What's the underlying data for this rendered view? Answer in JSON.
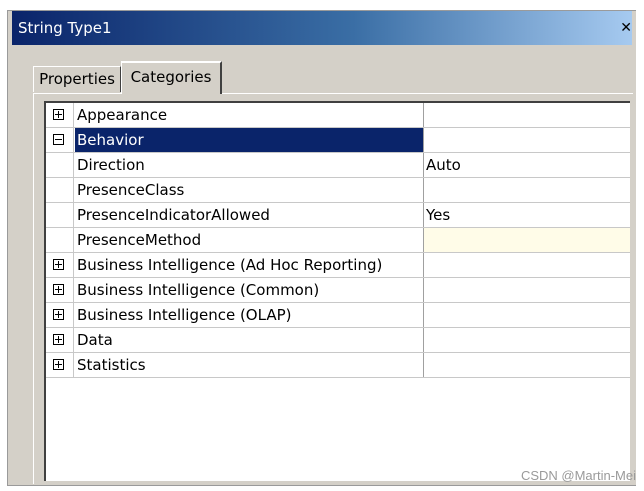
{
  "window": {
    "title": "String Type1",
    "close_glyph": "✕"
  },
  "tabs": [
    {
      "label": "Properties",
      "active": false
    },
    {
      "label": "Categories",
      "active": true
    }
  ],
  "grid": {
    "rows": [
      {
        "name": "Appearance",
        "value": "",
        "expander": "plus"
      },
      {
        "name": "Behavior",
        "value": "",
        "expander": "minus",
        "selected": true
      },
      {
        "name": "Direction",
        "value": "Auto"
      },
      {
        "name": "PresenceClass",
        "value": ""
      },
      {
        "name": "PresenceIndicatorAllowed",
        "value": "Yes"
      },
      {
        "name": "PresenceMethod",
        "value": "",
        "highlight": true
      },
      {
        "name": "Business Intelligence (Ad Hoc Reporting)",
        "value": "",
        "expander": "plus"
      },
      {
        "name": "Business Intelligence (Common)",
        "value": "",
        "expander": "plus"
      },
      {
        "name": "Business Intelligence (OLAP)",
        "value": "",
        "expander": "plus"
      },
      {
        "name": "Data",
        "value": "",
        "expander": "plus"
      },
      {
        "name": "Statistics",
        "value": "",
        "expander": "plus"
      }
    ]
  },
  "watermark": "CSDN @Martin-Mei",
  "colors": {
    "selection": "#0a246a",
    "title_gradient_start": "#0a246a",
    "highlight_cell": "#fffce8"
  }
}
